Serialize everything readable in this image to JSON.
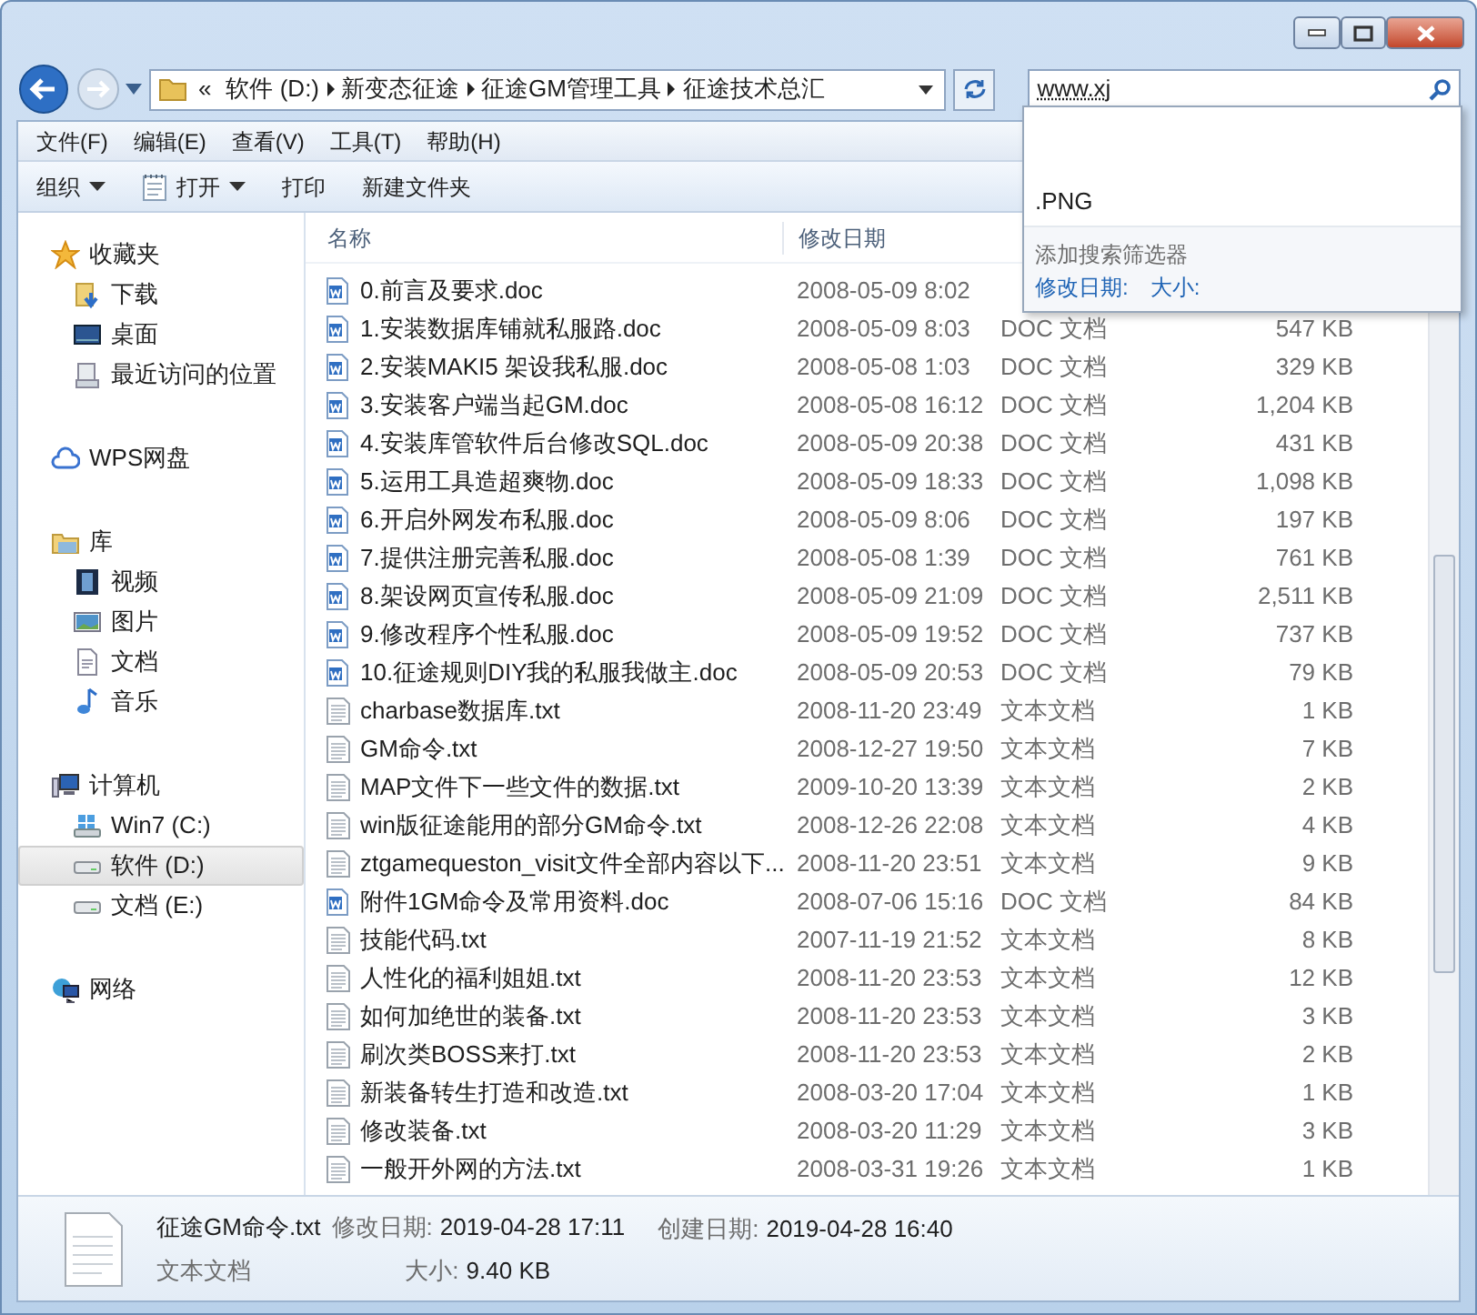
{
  "address": {
    "overflow": "«",
    "crumbs": [
      "软件 (D:)",
      "新变态征途",
      "征途GM管理工具",
      "征途技术总汇"
    ]
  },
  "search": {
    "value": "www.xj",
    "dropdown": {
      "suggestions": [
        ".PNG"
      ],
      "filter_label": "添加搜索筛选器",
      "filters": [
        "修改日期:",
        "大小:"
      ]
    }
  },
  "menu": [
    "文件(F)",
    "编辑(E)",
    "查看(V)",
    "工具(T)",
    "帮助(H)"
  ],
  "toolbar": [
    {
      "label": "组织",
      "dropdown": true,
      "kind": "text"
    },
    {
      "label": "打开",
      "dropdown": true,
      "kind": "open"
    },
    {
      "label": "打印",
      "dropdown": false,
      "kind": "text"
    },
    {
      "label": "新建文件夹",
      "dropdown": false,
      "kind": "text"
    }
  ],
  "sidebar": [
    {
      "label": "收藏夹",
      "kind": "star",
      "children": [
        {
          "label": "下载",
          "kind": "download",
          "selected": false
        },
        {
          "label": "桌面",
          "kind": "desktop",
          "selected": false
        },
        {
          "label": "最近访问的位置",
          "kind": "recent",
          "selected": false
        }
      ]
    },
    {
      "label": "WPS网盘",
      "kind": "cloud"
    },
    {
      "label": "库",
      "kind": "library",
      "children": [
        {
          "label": "视频",
          "kind": "video",
          "selected": false
        },
        {
          "label": "图片",
          "kind": "picture",
          "selected": false
        },
        {
          "label": "文档",
          "kind": "document",
          "selected": false
        },
        {
          "label": "音乐",
          "kind": "music",
          "selected": false
        }
      ]
    },
    {
      "label": "计算机",
      "kind": "computer",
      "children": [
        {
          "label": "Win7 (C:)",
          "kind": "system-drive",
          "selected": false
        },
        {
          "label": "软件 (D:)",
          "kind": "drive",
          "selected": true
        },
        {
          "label": "文档 (E:)",
          "kind": "drive",
          "selected": false
        }
      ]
    },
    {
      "label": "网络",
      "kind": "network"
    }
  ],
  "columns": [
    "名称",
    "修改日期"
  ],
  "files": [
    {
      "name": "0.前言及要求.doc",
      "date": "2008-05-09 8:02",
      "kind": "doc"
    },
    {
      "name": "1.安装数据库铺就私服路.doc",
      "date": "2008-05-09 8:03",
      "type": "DOC 文档",
      "size": "547 KB",
      "kind": "doc"
    },
    {
      "name": "2.安装MAKI5 架设我私服.doc",
      "date": "2008-05-08 1:03",
      "type": "DOC 文档",
      "size": "329 KB",
      "kind": "doc"
    },
    {
      "name": "3.安装客户端当起GM.doc",
      "date": "2008-05-08 16:12",
      "type": "DOC 文档",
      "size": "1,204 KB",
      "kind": "doc"
    },
    {
      "name": "4.安装库管软件后台修改SQL.doc",
      "date": "2008-05-09 20:38",
      "type": "DOC 文档",
      "size": "431 KB",
      "kind": "doc"
    },
    {
      "name": "5.运用工具造超爽物.doc",
      "date": "2008-05-09 18:33",
      "type": "DOC 文档",
      "size": "1,098 KB",
      "kind": "doc"
    },
    {
      "name": "6.开启外网发布私服.doc",
      "date": "2008-05-09 8:06",
      "type": "DOC 文档",
      "size": "197 KB",
      "kind": "doc"
    },
    {
      "name": "7.提供注册完善私服.doc",
      "date": "2008-05-08 1:39",
      "type": "DOC 文档",
      "size": "761 KB",
      "kind": "doc"
    },
    {
      "name": "8.架设网页宣传私服.doc",
      "date": "2008-05-09 21:09",
      "type": "DOC 文档",
      "size": "2,511 KB",
      "kind": "doc"
    },
    {
      "name": "9.修改程序个性私服.doc",
      "date": "2008-05-09 19:52",
      "type": "DOC 文档",
      "size": "737 KB",
      "kind": "doc"
    },
    {
      "name": "10.征途规则DIY我的私服我做主.doc",
      "date": "2008-05-09 20:53",
      "type": "DOC 文档",
      "size": "79 KB",
      "kind": "doc"
    },
    {
      "name": "charbase数据库.txt",
      "date": "2008-11-20 23:49",
      "type": "文本文档",
      "size": "1 KB",
      "kind": "txt"
    },
    {
      "name": "GM命令.txt",
      "date": "2008-12-27 19:50",
      "type": "文本文档",
      "size": "7 KB",
      "kind": "txt"
    },
    {
      "name": "MAP文件下一些文件的数据.txt",
      "date": "2009-10-20 13:39",
      "type": "文本文档",
      "size": "2 KB",
      "kind": "txt"
    },
    {
      "name": "win版征途能用的部分GM命令.txt",
      "date": "2008-12-26 22:08",
      "type": "文本文档",
      "size": "4 KB",
      "kind": "txt"
    },
    {
      "name": "ztgamequeston_visit文件全部内容以下...",
      "date": "2008-11-20 23:51",
      "type": "文本文档",
      "size": "9 KB",
      "kind": "txt"
    },
    {
      "name": "附件1GM命令及常用资料.doc",
      "date": "2008-07-06 15:16",
      "type": "DOC 文档",
      "size": "84 KB",
      "kind": "doc"
    },
    {
      "name": "技能代码.txt",
      "date": "2007-11-19 21:52",
      "type": "文本文档",
      "size": "8 KB",
      "kind": "txt"
    },
    {
      "name": "人性化的福利姐姐.txt",
      "date": "2008-11-20 23:53",
      "type": "文本文档",
      "size": "12 KB",
      "kind": "txt"
    },
    {
      "name": "如何加绝世的装备.txt",
      "date": "2008-11-20 23:53",
      "type": "文本文档",
      "size": "3 KB",
      "kind": "txt"
    },
    {
      "name": "刷次类BOSS来打.txt",
      "date": "2008-11-20 23:53",
      "type": "文本文档",
      "size": "2 KB",
      "kind": "txt"
    },
    {
      "name": "新装备转生打造和改造.txt",
      "date": "2008-03-20 17:04",
      "type": "文本文档",
      "size": "1 KB",
      "kind": "txt"
    },
    {
      "name": "修改装备.txt",
      "date": "2008-03-20 11:29",
      "type": "文本文档",
      "size": "3 KB",
      "kind": "txt"
    },
    {
      "name": "一般开外网的方法.txt",
      "date": "2008-03-31 19:26",
      "type": "文本文档",
      "size": "1 KB",
      "kind": "txt"
    }
  ],
  "details": {
    "name": "征途GM命令.txt",
    "type": "文本文档",
    "modified_label": "修改日期:",
    "modified": "2019-04-28 17:11",
    "created_label": "创建日期:",
    "created": "2019-04-28 16:40",
    "size_label": "大小:",
    "size": "9.40 KB"
  }
}
